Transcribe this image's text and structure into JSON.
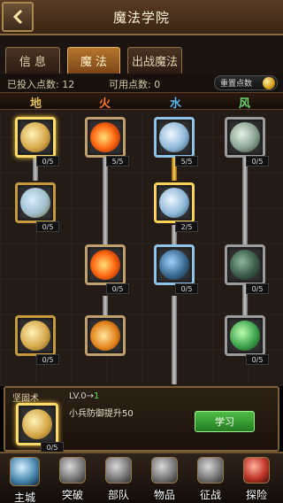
{
  "header": {
    "title": "魔法学院",
    "back_icon": "back-arrow-icon"
  },
  "tabs": [
    {
      "label": "信 息",
      "active": false
    },
    {
      "label": "魔 法",
      "active": true
    },
    {
      "label": "出战魔法",
      "active": false
    }
  ],
  "points": {
    "invested_label": "已投入点数:",
    "invested_value": "12",
    "available_label": "可用点数:",
    "available_value": "0",
    "reset_label": "重置点数"
  },
  "columns": {
    "earth": "地",
    "fire": "火",
    "water": "水",
    "wind": "风"
  },
  "skills": {
    "earth_1": {
      "level": "0/5",
      "icon": "earth-rune-icon"
    },
    "earth_2": {
      "level": "0/5",
      "icon": "earth-shrine-icon"
    },
    "earth_3": {
      "level": "0/5",
      "icon": "earth-sigil-icon"
    },
    "fire_1": {
      "level": "5/5",
      "icon": "fire-burst-icon"
    },
    "fire_2": {
      "level": "0/5",
      "icon": "fire-wave-icon"
    },
    "fire_3": {
      "level": "",
      "icon": "fire-rune-icon"
    },
    "water_1": {
      "level": "5/5",
      "icon": "water-blade-icon"
    },
    "water_2": {
      "level": "2/5",
      "icon": "water-storm-icon"
    },
    "water_3": {
      "level": "0/5",
      "icon": "water-beast-icon"
    },
    "wind_1": {
      "level": "0/5",
      "icon": "wind-spirit-icon"
    },
    "wind_2": {
      "level": "0/5",
      "icon": "wind-golem-icon"
    },
    "wind_3": {
      "level": "0/5",
      "icon": "wind-vortex-icon"
    }
  },
  "detail": {
    "name": "坚固术",
    "level": "0/5",
    "lv_prefix": "LV.0→",
    "lv_next": "1",
    "description": "小兵防御提升50",
    "learn_label": "学习"
  },
  "nav": [
    {
      "label": "主城",
      "icon": "castle-icon"
    },
    {
      "label": "突破",
      "icon": "helmet-icon"
    },
    {
      "label": "部队",
      "icon": "armor-icon"
    },
    {
      "label": "物品",
      "icon": "bag-icon"
    },
    {
      "label": "征战",
      "icon": "crossed-swords-icon"
    },
    {
      "label": "探险",
      "icon": "explore-flag-icon"
    }
  ],
  "colors": {
    "accent_gold": "#ffdb6a",
    "learn_green": "#4fbe46"
  }
}
